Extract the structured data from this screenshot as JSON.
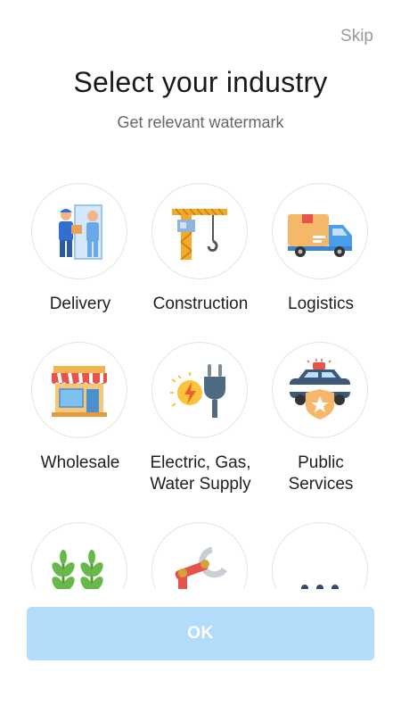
{
  "header": {
    "skip_label": "Skip",
    "title": "Select your industry",
    "subtitle": "Get relevant watermark"
  },
  "industries": [
    {
      "label": "Delivery",
      "icon": "delivery-people-icon"
    },
    {
      "label": "Construction",
      "icon": "crane-icon"
    },
    {
      "label": "Logistics",
      "icon": "truck-icon"
    },
    {
      "label": "Wholesale",
      "icon": "store-icon"
    },
    {
      "label": "Electric, Gas,\nWater Supply",
      "icon": "power-plug-icon"
    },
    {
      "label": "Public\nServices",
      "icon": "police-car-icon"
    },
    {
      "label": "",
      "icon": "agriculture-icon"
    },
    {
      "label": "",
      "icon": "robot-arm-icon"
    },
    {
      "label": "",
      "icon": "more-icon"
    }
  ],
  "footer": {
    "ok_label": "OK"
  },
  "colors": {
    "ok_button": "#b3dcfa",
    "accent_blue": "#2b7fe0"
  }
}
